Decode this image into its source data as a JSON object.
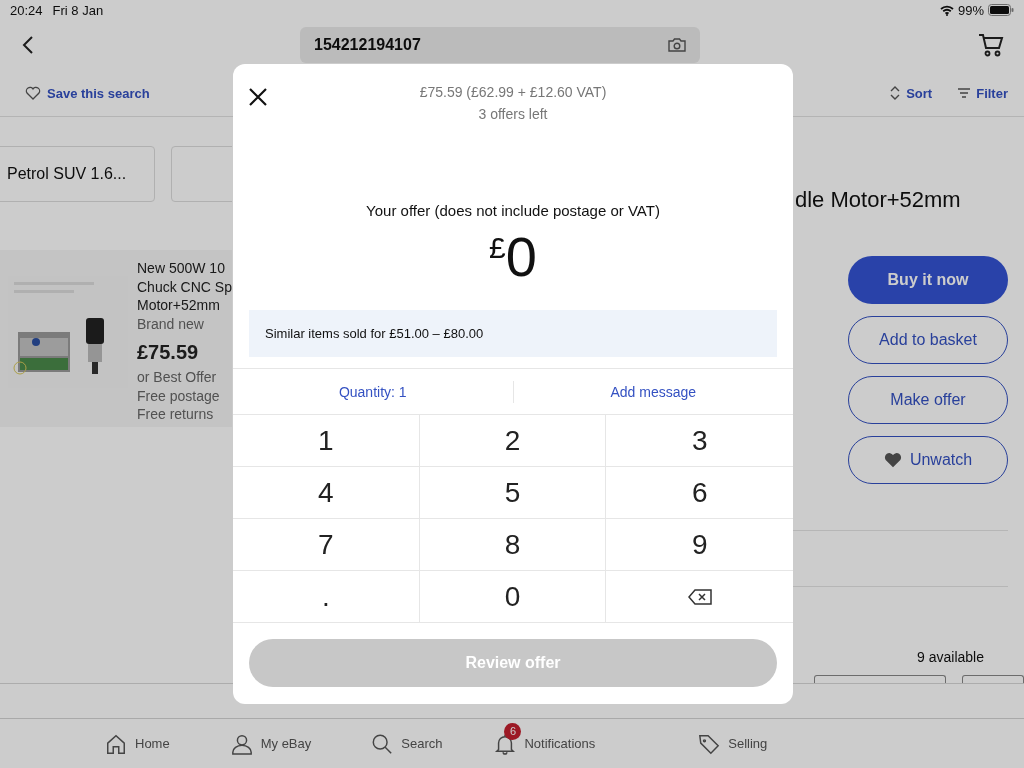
{
  "status_bar": {
    "time": "20:24",
    "date": "Fri 8 Jan",
    "battery": "99%"
  },
  "header": {
    "search_value": "154212194107"
  },
  "toolbar": {
    "save_search": "Save this search",
    "sort": "Sort",
    "filter": "Filter"
  },
  "chips": [
    {
      "label": "Petrol SUV 1.6..."
    }
  ],
  "listing": {
    "title_lines": [
      "New 500W 10",
      "Chuck CNC Sp",
      "Motor+52mm"
    ],
    "condition": "Brand new",
    "price": "£75.59",
    "offer": "or Best Offer",
    "postage": "Free postage",
    "returns": "Free returns"
  },
  "detail": {
    "title": "dle Motor+52mm",
    "buttons": [
      {
        "label": "Buy it now",
        "kind": "primary"
      },
      {
        "label": "Add to basket",
        "kind": "outline"
      },
      {
        "label": "Make offer",
        "kind": "outline"
      },
      {
        "label": "Unwatch",
        "kind": "watch"
      }
    ],
    "availability": "9 available"
  },
  "tab_bar": [
    {
      "label": "Home",
      "kind": "home"
    },
    {
      "label": "My eBay",
      "kind": "person"
    },
    {
      "label": "Search",
      "kind": "search"
    },
    {
      "label": "Notifications",
      "kind": "bell",
      "badge": "6"
    },
    {
      "label": "Selling",
      "kind": "tag"
    }
  ],
  "offer_dialog": {
    "price_summary": "£75.59 (£62.99 + £12.60 VAT)",
    "offers_left": "3 offers left",
    "prompt": "Your offer (does not include postage or VAT)",
    "currency": "£",
    "amount": "0",
    "similar": "Similar items sold for £51.00 – £80.00",
    "quantity": "Quantity: 1",
    "add_message": "Add message",
    "keypad": [
      {
        "label": "1"
      },
      {
        "label": "2"
      },
      {
        "label": "3"
      },
      {
        "label": "4"
      },
      {
        "label": "5"
      },
      {
        "label": "6"
      },
      {
        "label": "7"
      },
      {
        "label": "8"
      },
      {
        "label": "9"
      },
      {
        "label": "."
      },
      {
        "label": "0"
      },
      {
        "kind": "backspace"
      }
    ],
    "review_button": {
      "label": "Review offer",
      "disabled": true
    }
  }
}
